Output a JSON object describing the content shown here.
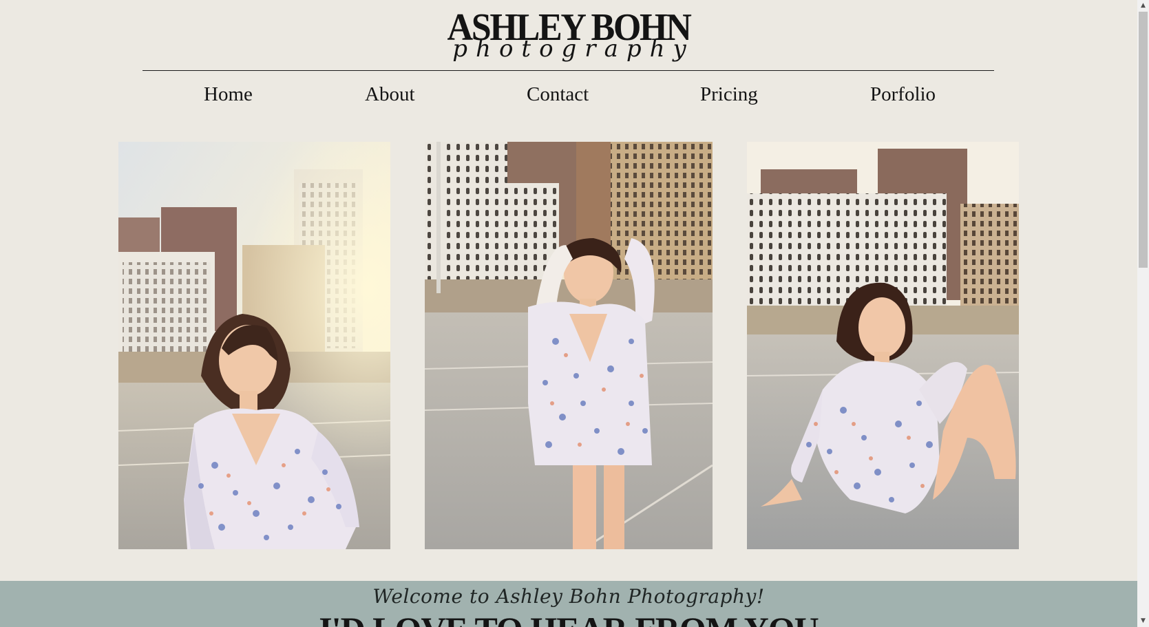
{
  "header": {
    "logo_main": "ASHLEY BOHN",
    "logo_sub": "photography"
  },
  "nav": {
    "items": [
      {
        "label": "Home"
      },
      {
        "label": "About"
      },
      {
        "label": "Contact"
      },
      {
        "label": "Pricing"
      },
      {
        "label": "Porfolio"
      }
    ]
  },
  "gallery": {
    "photos": [
      {
        "subject": "woman in floral dress on rooftop, city buildings, sunlight"
      },
      {
        "subject": "woman in floral dress standing, hands in hair, city buildings"
      },
      {
        "subject": "woman in floral dress sitting on rooftop, smiling"
      }
    ]
  },
  "welcome": {
    "script_line": "Welcome to Ashley Bohn Photography!",
    "headline": "I'D LOVE TO HEAR FROM YOU"
  },
  "colors": {
    "page_background": "#ece9e2",
    "band_background": "#a1b2af",
    "text": "#141414"
  },
  "icons": {
    "scroll_up": "triangle-up",
    "scroll_down": "triangle-down"
  }
}
